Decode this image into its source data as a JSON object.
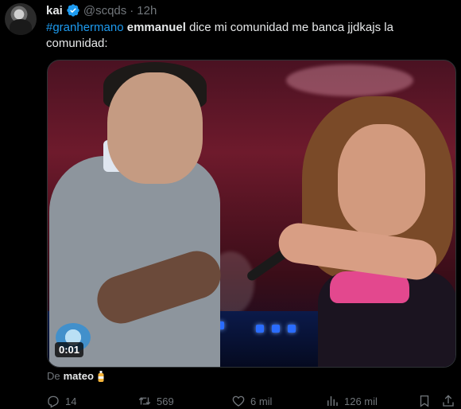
{
  "user": {
    "display_name": "kai",
    "handle": "@scqds",
    "separator": "·",
    "time": "12h"
  },
  "tweet": {
    "hashtag": "#granhermano",
    "bold_word": "emmanuel",
    "rest_text": " dice mi comunidad me banca jjdkajs  la comunidad:"
  },
  "media": {
    "duration": "0:01"
  },
  "attribution": {
    "prefix": "De",
    "name": "mateo"
  },
  "actions": {
    "reply_count": "14",
    "retweet_count": "569",
    "like_count": "6 mil",
    "views_count": "126 mil"
  },
  "icons": {
    "verified": "verified-badge-icon",
    "reply": "reply-icon",
    "retweet": "retweet-icon",
    "like": "heart-icon",
    "views": "views-icon",
    "bookmark": "bookmark-icon",
    "share": "share-icon"
  },
  "colors": {
    "background": "#000000",
    "text": "#e7e9ea",
    "muted": "#71767b",
    "accent": "#1d9bf0"
  }
}
